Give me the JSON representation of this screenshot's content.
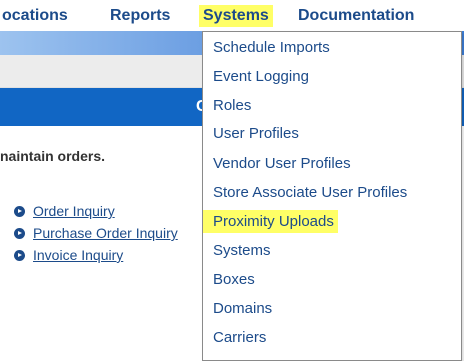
{
  "nav": {
    "items": [
      {
        "label": "ocations",
        "active": false
      },
      {
        "label": "Reports",
        "active": false
      },
      {
        "label": "Systems",
        "active": true
      },
      {
        "label": "Documentation",
        "active": false
      }
    ]
  },
  "banner": {
    "text": "C"
  },
  "main": {
    "intro": "naintain orders.",
    "links": [
      "Order Inquiry",
      "Purchase Order Inquiry",
      "Invoice Inquiry"
    ]
  },
  "dropdown": {
    "items": [
      "Schedule Imports",
      "Event Logging",
      "Roles",
      "User Profiles",
      "Vendor User Profiles",
      "Store Associate User Profiles",
      "Proximity Uploads",
      "Systems",
      "Boxes",
      "Domains",
      "Carriers"
    ],
    "highlighted_item": "Proximity Uploads"
  },
  "colors": {
    "link": "#1c4b8a",
    "highlight": "#ffff66",
    "banner": "#1166c4"
  }
}
